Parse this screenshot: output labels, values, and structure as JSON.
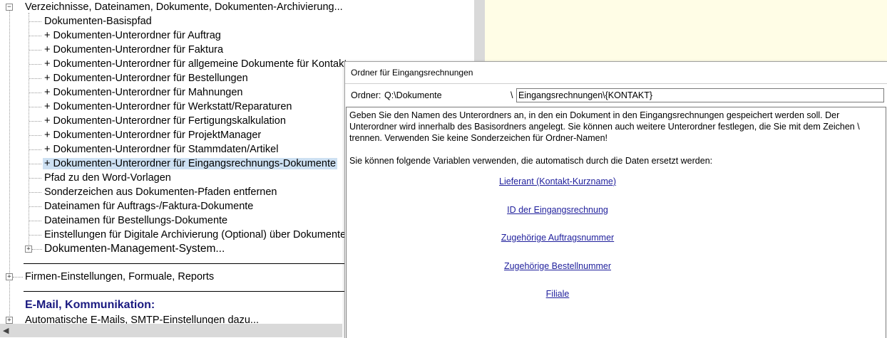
{
  "tree": {
    "root_label": "Verzeichnisse, Dateinamen, Dokumente, Dokumenten-Archivierung...",
    "items": [
      "Dokumenten-Basispfad",
      "+ Dokumenten-Unterordner für Auftrag",
      "+ Dokumenten-Unterordner für Faktura",
      "+ Dokumenten-Unterordner für allgemeine Dokumente für Kontakte",
      "+ Dokumenten-Unterordner für Bestellungen",
      "+ Dokumenten-Unterordner für Mahnungen",
      "+ Dokumenten-Unterordner für Werkstatt/Reparaturen",
      "+ Dokumenten-Unterordner für Fertigungskalkulation",
      "+ Dokumenten-Unterordner für ProjektManager",
      "+ Dokumenten-Unterordner für Stammdaten/Artikel",
      "+ Dokumenten-Unterordner für Eingangsrechnungs-Dokumente",
      "Pfad zu den Word-Vorlagen",
      "Sonderzeichen aus Dokumenten-Pfaden entfernen",
      "Dateinamen für Auftrags-/Faktura-Dokumente",
      "Dateinamen für Bestellungs-Dokumente",
      "Einstellungen für Digitale Archivierung (Optional) über Dokumente"
    ],
    "dms_label": "Dokumenten-Management-System...",
    "firmen_label": "Firmen-Einstellungen, Formuale, Reports",
    "email_header": "E-Mail, Kommunikation:",
    "email_item": "Automatische E-Mails, SMTP-Einstellungen dazu...",
    "expander_collapsed": "+",
    "expander_expanded": "−"
  },
  "popup": {
    "title": "Ordner für Eingangsrechnungen",
    "ordner_label": "Ordner:",
    "ordner_path": "Q:\\Dokumente",
    "backslash": "\\",
    "input_value": "Eingangsrechnungen\\{KONTAKT}",
    "description": "Geben Sie den Namen des Unterordners an, in den ein Dokument in den Eingangsrechnungen gespeichert werden soll. Der\nUnterordner wird innerhalb des Basisordners angelegt. Sie können auch weitere Unterordner festlegen, die Sie mit dem Zeichen \\\ntrennen. Verwenden Sie keine Sonderzeichen für Ordner-Namen!",
    "vars_intro": "Sie können folgende Variablen verwenden, die automatisch durch die Daten ersetzt werden:",
    "variables": [
      "Lieferant (Kontakt-Kurzname)",
      "ID der Eingangsrechnung",
      "Zugehörige Auftragsnummer",
      "Zugehörige Bestellnummer",
      "Filiale"
    ]
  },
  "colors": {
    "selection": "#cde0f2",
    "link": "#1f1f9c",
    "header": "#1a1a80",
    "side_panel": "#fffde6"
  }
}
